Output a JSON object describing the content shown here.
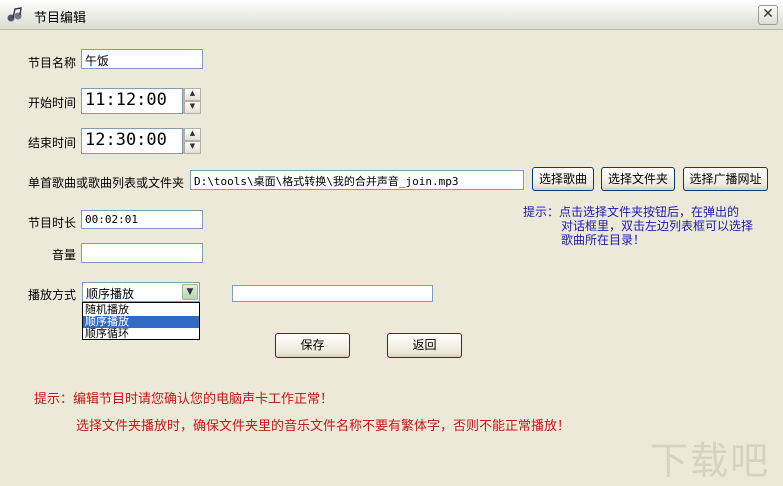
{
  "window": {
    "title": "节目编辑",
    "close": "✕"
  },
  "labels": {
    "name": "节目名称",
    "start": "开始时间",
    "end": "结束时间",
    "song": "单首歌曲或歌曲列表或文件夹",
    "duration": "节目时长",
    "volume": "音量",
    "mode": "播放方式"
  },
  "fields": {
    "name": "午饭",
    "start": "11:12:00",
    "end": "12:30:00",
    "song_path": "D:\\tools\\桌面\\格式转换\\我的合并声音_join.mp3",
    "duration": "00:02:01",
    "volume": "",
    "extra": ""
  },
  "buttons": {
    "select_song": "选择歌曲",
    "select_folder": "选择文件夹",
    "select_url": "选择广播网址",
    "save": "保存",
    "back": "返回"
  },
  "play_mode": {
    "selected": "顺序播放",
    "options": [
      "随机播放",
      "顺序播放",
      "顺序循环"
    ],
    "highlighted_index": 1
  },
  "hint_blue": [
    "提示：点击选择文件夹按钮后，在弹出的",
    "对话框里，双击左边列表框可以选择",
    "歌曲所在目录！"
  ],
  "hint_red": [
    "提示：编辑节目时请您确认您的电脑声卡工作正常！",
    "选择文件夹播放时，确保文件夹里的音乐文件名称不要有繁体字，否则不能正常播放！"
  ],
  "watermark": "下载吧",
  "colors": {
    "hint_blue": "#1b1bb0",
    "hint_red": "#c81818",
    "selection": "#316ac5"
  }
}
